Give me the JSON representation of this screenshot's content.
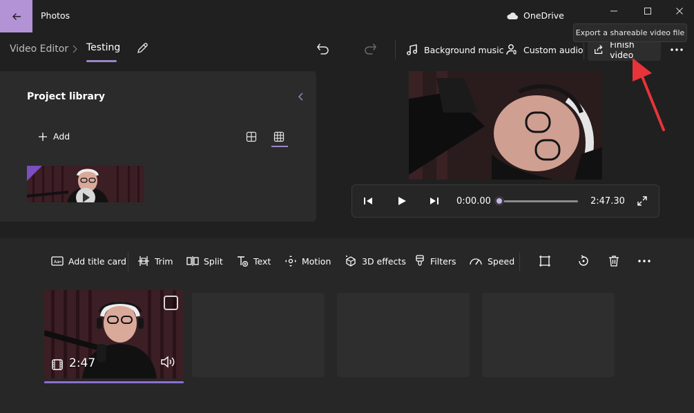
{
  "titlebar": {
    "app_title": "Photos",
    "cloud_label": "OneDrive"
  },
  "header": {
    "breadcrumb_root": "Video Editor",
    "project_name": "Testing",
    "background_music": "Background music",
    "custom_audio": "Custom audio",
    "finish_video": "Finish video",
    "tooltip": "Export a shareable video file"
  },
  "library": {
    "title": "Project library",
    "add_label": "Add"
  },
  "player": {
    "current_time": "0:00.00",
    "total_time": "2:47.30",
    "progress": 0.0
  },
  "toolbar": {
    "add_title_card": "Add title card",
    "trim": "Trim",
    "split": "Split",
    "text": "Text",
    "motion": "Motion",
    "effects_3d": "3D effects",
    "filters": "Filters",
    "speed": "Speed"
  },
  "storyboard": {
    "clip_duration": "2:47"
  },
  "colors": {
    "accent": "#9d86c9",
    "back_button": "#b492d6",
    "pointer": "#e8333a"
  },
  "icons": [
    "back-arrow-icon",
    "cloud-icon",
    "minimize-icon",
    "maximize-icon",
    "close-icon",
    "chevron-right-icon",
    "pencil-icon",
    "undo-icon",
    "redo-icon",
    "music-note-icon",
    "microphone-person-icon",
    "share-icon",
    "more-icon",
    "chevron-left-icon",
    "plus-icon",
    "grid-large-icon",
    "grid-small-icon",
    "skip-back-icon",
    "play-icon",
    "skip-forward-icon",
    "fullscreen-icon",
    "title-card-icon",
    "trim-icon",
    "split-icon",
    "text-icon",
    "motion-icon",
    "effects-3d-icon",
    "filters-icon",
    "speed-icon",
    "crop-icon",
    "rotate-icon",
    "trash-icon",
    "film-icon",
    "volume-icon"
  ]
}
